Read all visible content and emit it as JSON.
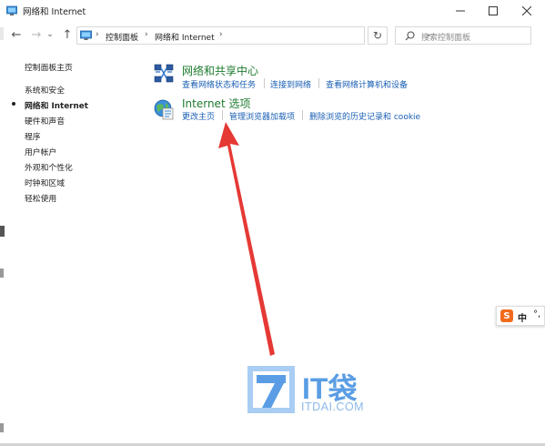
{
  "window": {
    "title": "网络和 Internet",
    "controls": {
      "minimize": "—",
      "maximize": "☐",
      "close": "✕"
    }
  },
  "navbar": {
    "back_glyph": "←",
    "forward_glyph": "→",
    "recent_glyph": "⌄",
    "up_glyph": "↑",
    "breadcrumb": [
      "控制面板",
      "网络和 Internet"
    ],
    "separator": "›",
    "dropdown_glyph": "⌄",
    "refresh_glyph": "↻",
    "search_placeholder": "搜索控制面板"
  },
  "sidebar": {
    "items": [
      {
        "label": "控制面板主页"
      },
      {
        "label": "系统和安全"
      },
      {
        "label": "网络和 Internet"
      },
      {
        "label": "硬件和声音"
      },
      {
        "label": "程序"
      },
      {
        "label": "用户帐户"
      },
      {
        "label": "外观和个性化"
      },
      {
        "label": "时钟和区域"
      },
      {
        "label": "轻松使用"
      }
    ],
    "active_index": 2
  },
  "categories": [
    {
      "title": "网络和共享中心",
      "icon": "network-sharing-icon",
      "links": [
        "查看网络状态和任务",
        "连接到网络",
        "查看网络计算机和设备"
      ]
    },
    {
      "title": "Internet 选项",
      "icon": "internet-options-icon",
      "links": [
        "更改主页",
        "管理浏览器加载项",
        "删除浏览的历史记录和 cookie"
      ]
    }
  ],
  "ime": {
    "logo": "S",
    "mode": "中",
    "punct": "°,"
  },
  "watermark": {
    "brand": "IT袋",
    "domain": "ITDAI.COM"
  },
  "colors": {
    "link": "#1a5fb4",
    "category_title": "#1e7b2f",
    "annotation_arrow": "#e53935",
    "watermark": "#5a9de4"
  }
}
